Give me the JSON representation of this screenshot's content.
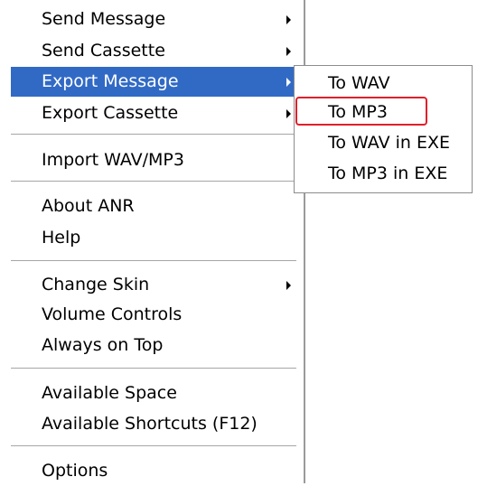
{
  "menu": {
    "items": [
      {
        "label": "Send Message",
        "submenu": true,
        "active": false
      },
      {
        "label": "Send Cassette",
        "submenu": true,
        "active": false
      },
      {
        "label": "Export Message",
        "submenu": true,
        "active": true
      },
      {
        "label": "Export Cassette",
        "submenu": true,
        "active": false
      },
      {
        "label": "Import WAV/MP3",
        "submenu": false,
        "active": false
      },
      {
        "label": "About ANR",
        "submenu": false,
        "active": false
      },
      {
        "label": "Help",
        "submenu": false,
        "active": false
      },
      {
        "label": "Change Skin",
        "submenu": true,
        "active": false
      },
      {
        "label": "Volume Controls",
        "submenu": false,
        "active": false
      },
      {
        "label": "Always on Top",
        "submenu": false,
        "active": false
      },
      {
        "label": "Available Space",
        "submenu": false,
        "active": false
      },
      {
        "label": "Available Shortcuts (F12)",
        "submenu": false,
        "active": false
      },
      {
        "label": "Options",
        "submenu": false,
        "active": false
      }
    ]
  },
  "submenu": {
    "parent": "Export Message",
    "items": [
      {
        "label": "To WAV"
      },
      {
        "label": "To MP3",
        "highlighted": true
      },
      {
        "label": "To WAV in EXE"
      },
      {
        "label": "To MP3 in EXE"
      }
    ]
  },
  "colors": {
    "selection": "#316ac5",
    "highlight_outline": "#e0202a"
  }
}
